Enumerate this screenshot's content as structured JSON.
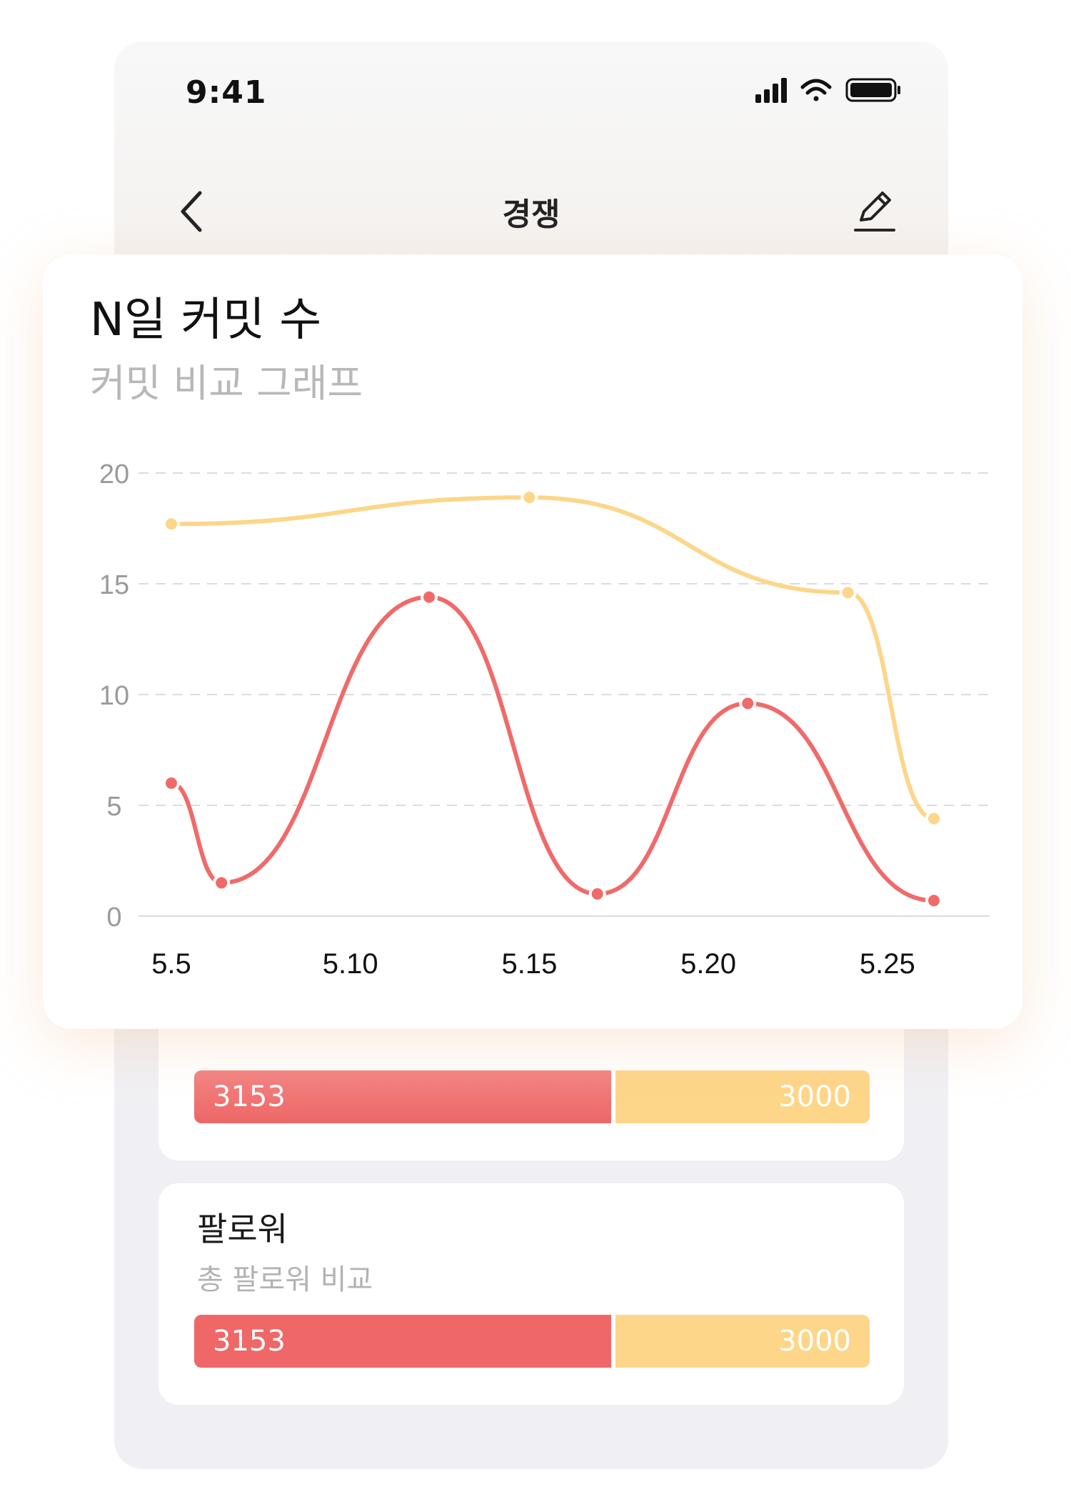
{
  "status_bar": {
    "time": "9:41"
  },
  "nav": {
    "title": "경쟁"
  },
  "chart_card": {
    "title": "N일 커밋 수",
    "subtitle": "커밋 비교 그래프"
  },
  "chart_data": {
    "type": "line",
    "title": "N일 커밋 수",
    "subtitle": "커밋 비교 그래프",
    "ylim": [
      0,
      20
    ],
    "y_ticks": [
      0,
      5,
      10,
      15,
      20
    ],
    "x_ticks": [
      5,
      10,
      15,
      20,
      25
    ],
    "x_tick_labels": [
      "5.5",
      "5.10",
      "5.15",
      "5.20",
      "5.25"
    ],
    "grid": true,
    "series": [
      {
        "color": "#f06a6a",
        "points": [
          {
            "x": 5.0,
            "y": 6.0
          },
          {
            "x": 6.4,
            "y": 1.5
          },
          {
            "x": 12.2,
            "y": 14.4
          },
          {
            "x": 16.9,
            "y": 1.0
          },
          {
            "x": 21.1,
            "y": 9.6
          },
          {
            "x": 26.3,
            "y": 0.7
          }
        ]
      },
      {
        "color": "#fdd68a",
        "points": [
          {
            "x": 5.0,
            "y": 17.7
          },
          {
            "x": 15.0,
            "y": 18.9
          },
          {
            "x": 23.9,
            "y": 14.6
          },
          {
            "x": 26.3,
            "y": 4.4
          }
        ]
      }
    ]
  },
  "cards": [
    {
      "title": "",
      "subtitle": "",
      "left_value": "3153",
      "right_value": "3000"
    },
    {
      "title": "팔로워",
      "subtitle": "총 팔로워 비교",
      "left_value": "3153",
      "right_value": "3000"
    }
  ],
  "colors": {
    "red": "#f06a6a",
    "yellow": "#fdd68a",
    "background": "#f0f0f4"
  },
  "icons": {
    "back": "chevron-left-icon",
    "edit": "pencil-icon",
    "signal": "cellular-signal-icon",
    "wifi": "wifi-icon",
    "battery": "battery-icon"
  }
}
